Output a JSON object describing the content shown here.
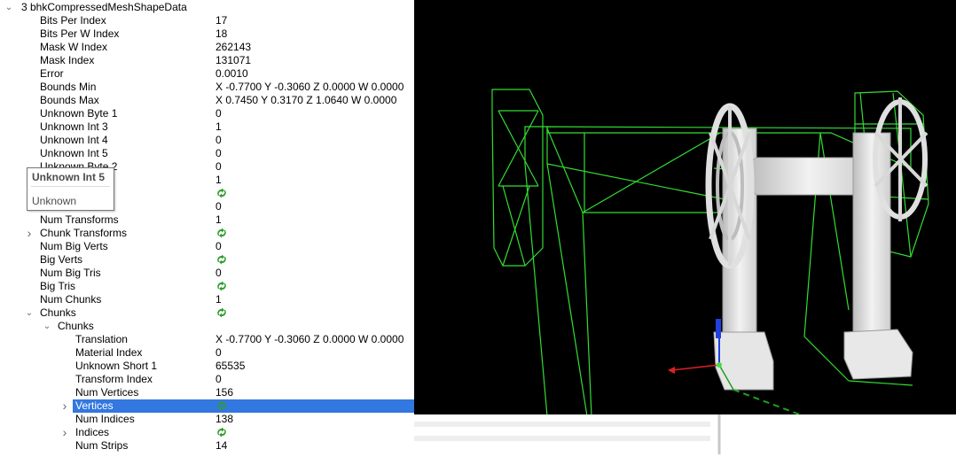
{
  "tree": {
    "root": {
      "label": "3 bhkCompressedMeshShapeData"
    },
    "rows": [
      {
        "name": "Bits Per Index",
        "value": "17"
      },
      {
        "name": "Bits Per W Index",
        "value": "18"
      },
      {
        "name": "Mask W Index",
        "value": "262143"
      },
      {
        "name": "Mask Index",
        "value": "131071"
      },
      {
        "name": "Error",
        "value": "0.0010"
      },
      {
        "name": "Bounds Min",
        "value": "X -0.7700 Y -0.3060 Z 0.0000 W 0.0000"
      },
      {
        "name": "Bounds Max",
        "value": "X 0.7450 Y 0.3170 Z 1.0640 W 0.0000"
      },
      {
        "name": "Unknown Byte 1",
        "value": "0"
      },
      {
        "name": "Unknown Int 3",
        "value": "1"
      },
      {
        "name": "Unknown Int 4",
        "value": "0"
      },
      {
        "name": "Unknown Int 5",
        "value": "0"
      },
      {
        "name": "Unknown Byte 2",
        "value": "0"
      },
      {
        "name": "",
        "value": "1"
      },
      {
        "name": "",
        "value": ""
      },
      {
        "name": "",
        "value": "0"
      },
      {
        "name": "Num Transforms",
        "value": "1"
      },
      {
        "name": "Chunk Transforms",
        "value": ""
      },
      {
        "name": "Num Big Verts",
        "value": "0"
      },
      {
        "name": "Big Verts",
        "value": ""
      },
      {
        "name": "Num Big Tris",
        "value": "0"
      },
      {
        "name": "Big Tris",
        "value": ""
      },
      {
        "name": "Num Chunks",
        "value": "1"
      },
      {
        "name": "Chunks",
        "value": ""
      },
      {
        "name": "Chunks",
        "value": ""
      },
      {
        "name": "Translation",
        "value": "X -0.7700 Y -0.3060 Z 0.0000 W 0.0000"
      },
      {
        "name": "Material Index",
        "value": "0"
      },
      {
        "name": "Unknown Short 1",
        "value": "65535"
      },
      {
        "name": "Transform Index",
        "value": "0"
      },
      {
        "name": "Num Vertices",
        "value": "156"
      },
      {
        "name": "Vertices",
        "value": ""
      },
      {
        "name": "Num Indices",
        "value": "138"
      },
      {
        "name": "Indices",
        "value": ""
      },
      {
        "name": "Num Strips",
        "value": "14"
      }
    ]
  },
  "tooltip": {
    "title": "Unknown Int 5",
    "description": "Unknown"
  },
  "icons": {
    "expand_collapsed": "chevron-right-icon",
    "expand_open": "chevron-down-icon",
    "array_values": "recycle-icon"
  },
  "colors": {
    "selection": "#3377e0",
    "viewport_background": "#000000",
    "wireframe": "#33dd33",
    "axis_x": "#e02020",
    "axis_y": "#20a020",
    "axis_z": "#2040e0",
    "array_icon": "#2e9e2e"
  }
}
